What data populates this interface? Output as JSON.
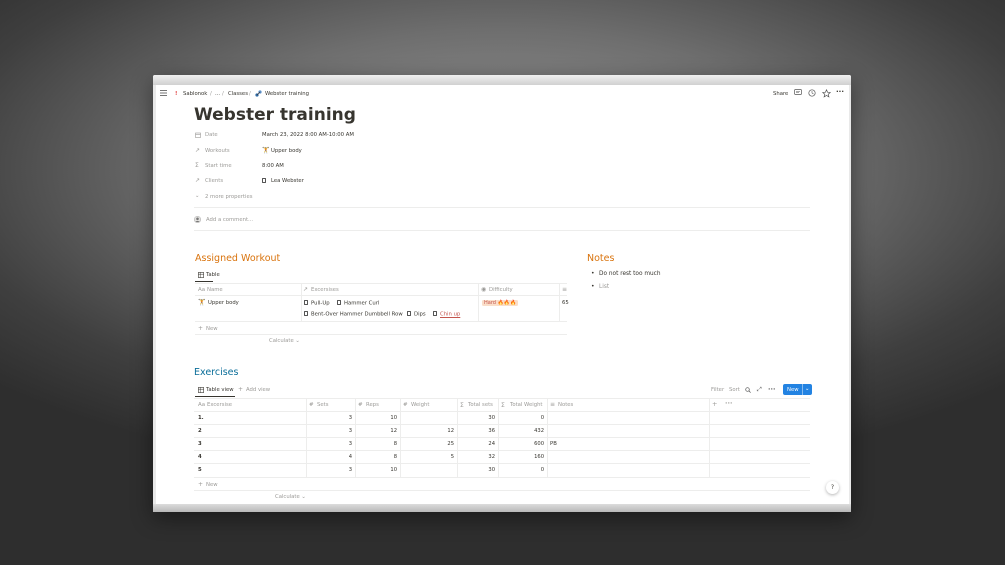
{
  "breadcrumb": {
    "workspace": "Sablonok",
    "ellipsis": "...",
    "section": "Classes",
    "page": "Webster training"
  },
  "topbar": {
    "share_label": "Share"
  },
  "page": {
    "title": "Webster training"
  },
  "properties": [
    {
      "label": "Date",
      "value": "March 23, 2022 8:00 AM-10:00 AM"
    },
    {
      "label": "Workouts",
      "value": "Upper body"
    },
    {
      "label": "Start time",
      "value": "8:00 AM"
    },
    {
      "label": "Clients",
      "value": "Lea Webster"
    }
  ],
  "more_properties": "2 more properties",
  "comment_placeholder": "Add a comment...",
  "assigned": {
    "heading": "Assigned Workout",
    "view_label": "Table",
    "columns": [
      "Name",
      "Excersises",
      "Difficulty"
    ],
    "row": {
      "name": "Upper body",
      "exercises": [
        "Pull-Up",
        "Hammer Curl",
        "Bent-Over Hammer Dumbbell Row",
        "Dips",
        "Chin up"
      ],
      "difficulty": "Hard 🔥🔥🔥",
      "extra": "65"
    },
    "new_label": "New",
    "calculate_label": "Calculate"
  },
  "notes": {
    "heading": "Notes",
    "items": [
      "Do not rest too much"
    ],
    "list_placeholder": "List"
  },
  "exercises": {
    "heading": "Exercises",
    "view_label": "Table view",
    "add_view_label": "Add view",
    "filter_label": "Filter",
    "sort_label": "Sort",
    "new_button_label": "New",
    "columns": [
      "Excersise",
      "Sets",
      "Reps",
      "Weight",
      "Total sets",
      "Total Weight",
      "Notes"
    ],
    "rows": [
      {
        "exercise": "1.",
        "sets": "3",
        "reps": "10",
        "weight": "",
        "total_sets": "30",
        "total_weight": "0",
        "notes": ""
      },
      {
        "exercise": "2",
        "sets": "3",
        "reps": "12",
        "weight": "12",
        "total_sets": "36",
        "total_weight": "432",
        "notes": ""
      },
      {
        "exercise": "3",
        "sets": "3",
        "reps": "8",
        "weight": "25",
        "total_sets": "24",
        "total_weight": "600",
        "notes": "PB"
      },
      {
        "exercise": "4",
        "sets": "4",
        "reps": "8",
        "weight": "5",
        "total_sets": "32",
        "total_weight": "160",
        "notes": ""
      },
      {
        "exercise": "5",
        "sets": "3",
        "reps": "10",
        "weight": "",
        "total_sets": "30",
        "total_weight": "0",
        "notes": ""
      }
    ],
    "new_label": "New",
    "calculate_label": "Calculate"
  },
  "help_label": "?",
  "colors": {
    "accent_orange": "#d9730d",
    "accent_blue": "#0b6e99",
    "primary_button": "#2383e2",
    "hard_tag_bg": "#fadec9"
  }
}
